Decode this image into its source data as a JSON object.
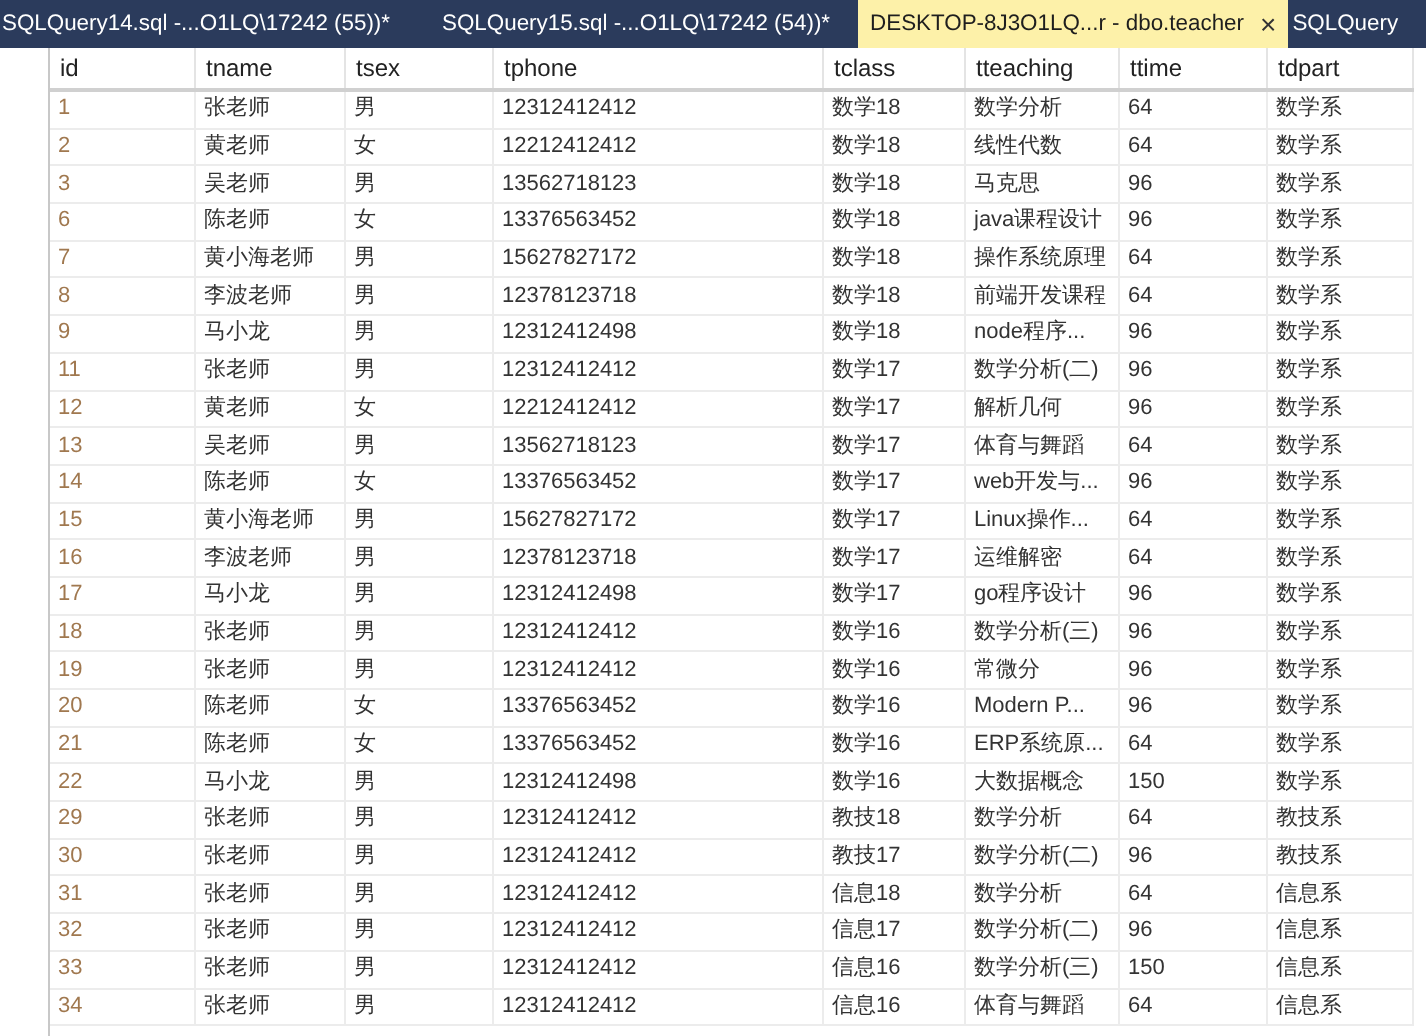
{
  "tabs": [
    {
      "label": "SQLQuery14.sql -...O1LQ\\17242 (55))*",
      "selected": false
    },
    {
      "label": "SQLQuery15.sql -...O1LQ\\17242 (54))*",
      "selected": false
    },
    {
      "label": "DESKTOP-8J3O1LQ...r - dbo.teacher",
      "selected": true,
      "close": "×"
    },
    {
      "label": "SQLQuery",
      "selected": false
    }
  ],
  "table": {
    "columns": [
      "id",
      "tname",
      "tsex",
      "tphone",
      "tclass",
      "tteaching",
      "ttime",
      "tdpart"
    ],
    "rows": [
      [
        "1",
        "张老师",
        "男",
        "12312412412",
        "数学18",
        "数学分析",
        "64",
        "数学系"
      ],
      [
        "2",
        "黄老师",
        "女",
        "12212412412",
        "数学18",
        "线性代数",
        "64",
        "数学系"
      ],
      [
        "3",
        "吴老师",
        "男",
        "13562718123",
        "数学18",
        "马克思",
        "96",
        "数学系"
      ],
      [
        "6",
        "陈老师",
        "女",
        "13376563452",
        "数学18",
        "java课程设计",
        "96",
        "数学系"
      ],
      [
        "7",
        "黄小海老师",
        "男",
        "15627827172",
        "数学18",
        "操作系统原理",
        "64",
        "数学系"
      ],
      [
        "8",
        "李波老师",
        "男",
        "12378123718",
        "数学18",
        "前端开发课程",
        "64",
        "数学系"
      ],
      [
        "9",
        "马小龙",
        "男",
        "12312412498",
        "数学18",
        "node程序...",
        "96",
        "数学系"
      ],
      [
        "11",
        "张老师",
        "男",
        "12312412412",
        "数学17",
        "数学分析(二)",
        "96",
        "数学系"
      ],
      [
        "12",
        "黄老师",
        "女",
        "12212412412",
        "数学17",
        "解析几何",
        "96",
        "数学系"
      ],
      [
        "13",
        "吴老师",
        "男",
        "13562718123",
        "数学17",
        "体育与舞蹈",
        "64",
        "数学系"
      ],
      [
        "14",
        "陈老师",
        "女",
        "13376563452",
        "数学17",
        "web开发与...",
        "96",
        "数学系"
      ],
      [
        "15",
        "黄小海老师",
        "男",
        "15627827172",
        "数学17",
        "Linux操作...",
        "64",
        "数学系"
      ],
      [
        "16",
        "李波老师",
        "男",
        "12378123718",
        "数学17",
        "运维解密",
        "64",
        "数学系"
      ],
      [
        "17",
        "马小龙",
        "男",
        "12312412498",
        "数学17",
        "go程序设计",
        "96",
        "数学系"
      ],
      [
        "18",
        "张老师",
        "男",
        "12312412412",
        "数学16",
        "数学分析(三)",
        "96",
        "数学系"
      ],
      [
        "19",
        "张老师",
        "男",
        "12312412412",
        "数学16",
        "常微分",
        "96",
        "数学系"
      ],
      [
        "20",
        "陈老师",
        "女",
        "13376563452",
        "数学16",
        "Modern P...",
        "96",
        "数学系"
      ],
      [
        "21",
        "陈老师",
        "女",
        "13376563452",
        "数学16",
        "ERP系统原...",
        "64",
        "数学系"
      ],
      [
        "22",
        "马小龙",
        "男",
        "12312412498",
        "数学16",
        "大数据概念",
        "150",
        "数学系"
      ],
      [
        "29",
        "张老师",
        "男",
        "12312412412",
        "教技18",
        "数学分析",
        "64",
        "教技系"
      ],
      [
        "30",
        "张老师",
        "男",
        "12312412412",
        "教技17",
        "数学分析(二)",
        "96",
        "教技系"
      ],
      [
        "31",
        "张老师",
        "男",
        "12312412412",
        "信息18",
        "数学分析",
        "64",
        "信息系"
      ],
      [
        "32",
        "张老师",
        "男",
        "12312412412",
        "信息17",
        "数学分析(二)",
        "96",
        "信息系"
      ],
      [
        "33",
        "张老师",
        "男",
        "12312412412",
        "信息16",
        "数学分析(三)",
        "150",
        "信息系"
      ],
      [
        "34",
        "张老师",
        "男",
        "12312412412",
        "信息16",
        "体育与舞蹈",
        "64",
        "信息系"
      ]
    ]
  }
}
